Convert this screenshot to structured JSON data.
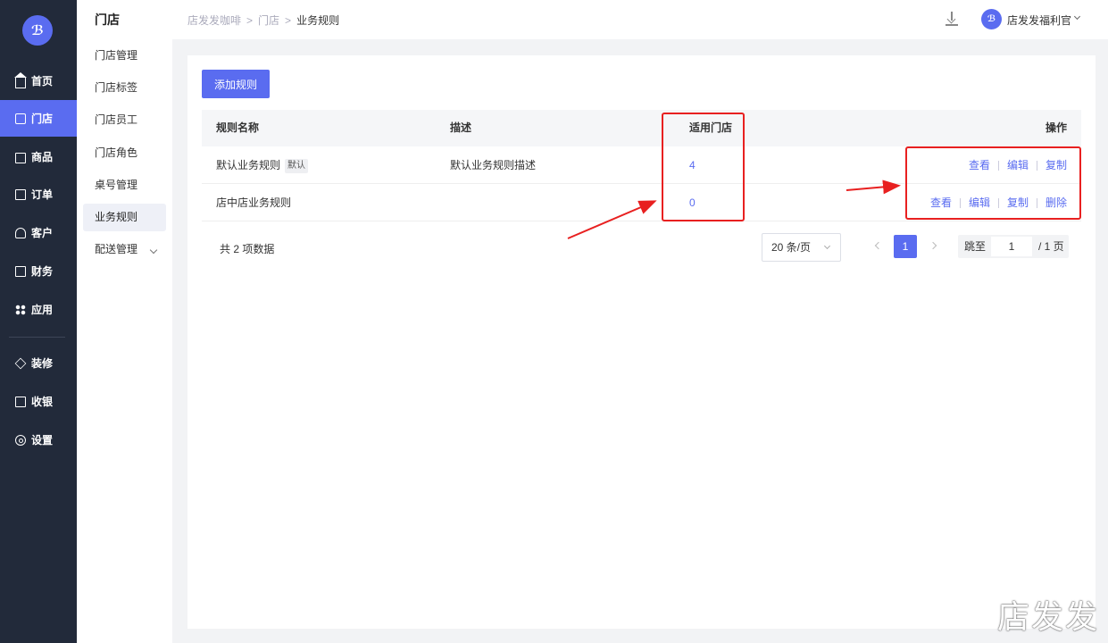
{
  "nav": {
    "logo_text": "ℬ",
    "items": [
      {
        "label": "首页",
        "icon": "home-icon"
      },
      {
        "label": "门店",
        "icon": "store-icon",
        "active": true
      },
      {
        "label": "商品",
        "icon": "bag-icon"
      },
      {
        "label": "订单",
        "icon": "order-icon"
      },
      {
        "label": "客户",
        "icon": "user-icon"
      },
      {
        "label": "财务",
        "icon": "card-icon"
      },
      {
        "label": "应用",
        "icon": "grid-icon"
      },
      {
        "label": "装修",
        "icon": "layers-icon"
      },
      {
        "label": "收银",
        "icon": "cashier-icon"
      },
      {
        "label": "设置",
        "icon": "gear-icon"
      }
    ],
    "accent": "#5a6cf0"
  },
  "subnav": {
    "title": "门店",
    "items": [
      {
        "label": "门店管理"
      },
      {
        "label": "门店标签"
      },
      {
        "label": "门店员工"
      },
      {
        "label": "门店角色"
      },
      {
        "label": "桌号管理"
      },
      {
        "label": "业务规则",
        "active": true
      },
      {
        "label": "配送管理",
        "expandable": true
      }
    ]
  },
  "header": {
    "breadcrumb": [
      "店发发咖啡",
      "门店",
      "业务规则"
    ],
    "user_name": "店发发福利官",
    "avatar_text": "ℬ"
  },
  "toolbar": {
    "add_label": "添加规则"
  },
  "table": {
    "columns": [
      "规则名称",
      "描述",
      "适用门店",
      "操作"
    ],
    "rows": [
      {
        "name": "默认业务规则",
        "tag": "默认",
        "desc": "默认业务规则描述",
        "stores": "4",
        "actions": [
          "查看",
          "编辑",
          "复制"
        ]
      },
      {
        "name": "店中店业务规则",
        "tag": "",
        "desc": "",
        "stores": "0",
        "actions": [
          "查看",
          "编辑",
          "复制",
          "删除"
        ]
      }
    ]
  },
  "pagination": {
    "total_text": "共 2 项数据",
    "page_size": "20 条/页",
    "current_page": "1",
    "jump_label": "跳至",
    "jump_value": "1",
    "total_pages": "/ 1 页"
  },
  "watermark": "店发发"
}
